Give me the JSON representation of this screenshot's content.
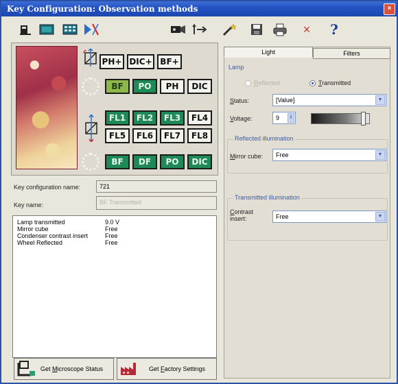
{
  "window": {
    "title": "Key Configuration: Observation methods",
    "close": "×"
  },
  "toolbar": {
    "left_icons": [
      "microscope-icon",
      "camera-panel-icon",
      "grid-panel-icon",
      "objective-icon"
    ],
    "right_icons": [
      "projector-icon",
      "transfer-icon",
      "wand-icon",
      "save-icon",
      "print-icon",
      "delete-icon",
      "help-icon"
    ],
    "glyphs": {
      "delete": "×",
      "help": "?"
    }
  },
  "methods": {
    "row1": [
      "PH+",
      "DIC+",
      "BF+"
    ],
    "row2": [
      "BF",
      "PO",
      "PH",
      "DIC"
    ],
    "fl_row1": [
      "FL1",
      "FL2",
      "FL3",
      "FL4"
    ],
    "fl_row2": [
      "FL5",
      "FL6",
      "FL7",
      "FL8"
    ],
    "row5": [
      "BF",
      "DF",
      "PO",
      "DIC"
    ]
  },
  "key_config": {
    "name_label": "Key configuration name:",
    "name_value": "721",
    "key_name_label": "Key name:",
    "key_name_value": "BF Transmitted"
  },
  "settings_list": [
    {
      "name": "Lamp transmitted",
      "value": "9.0 V"
    },
    {
      "name": "Mirror cube",
      "value": "Free"
    },
    {
      "name": "Condenser contrast insert",
      "value": "Free"
    },
    {
      "name": "Wheel Reflected",
      "value": "Free"
    }
  ],
  "buttons": {
    "status": {
      "pre": "Get ",
      "u": "M",
      "post": "icroscope Status"
    },
    "factory": {
      "pre": "Get ",
      "u": "F",
      "post": "actory Settings"
    }
  },
  "tabs": {
    "light": "Light",
    "filters": "Filters"
  },
  "lamp": {
    "group": "Lamp",
    "reflected": {
      "u": "R",
      "rest": "eflected"
    },
    "transmitted": {
      "u": "T",
      "rest": "ransmitted"
    },
    "status_label": {
      "u": "S",
      "rest": "tatus:"
    },
    "status_value": "[Value]",
    "voltage_label": {
      "u": "V",
      "rest": "oltage:"
    },
    "voltage_value": "9"
  },
  "reflected_illum": {
    "group": "Reflected illumination",
    "label": {
      "u": "M",
      "rest": "irror cube:"
    },
    "value": "Free"
  },
  "transmitted_illum": {
    "group": "Transmitted illumination",
    "label": {
      "u": "C",
      "rest": "ontrast"
    },
    "label2": "insert:",
    "value": "Free"
  },
  "colors": {
    "titlebar": "#2353c2",
    "method_green": "#1f8a57",
    "method_white": "#f4f4ef"
  }
}
